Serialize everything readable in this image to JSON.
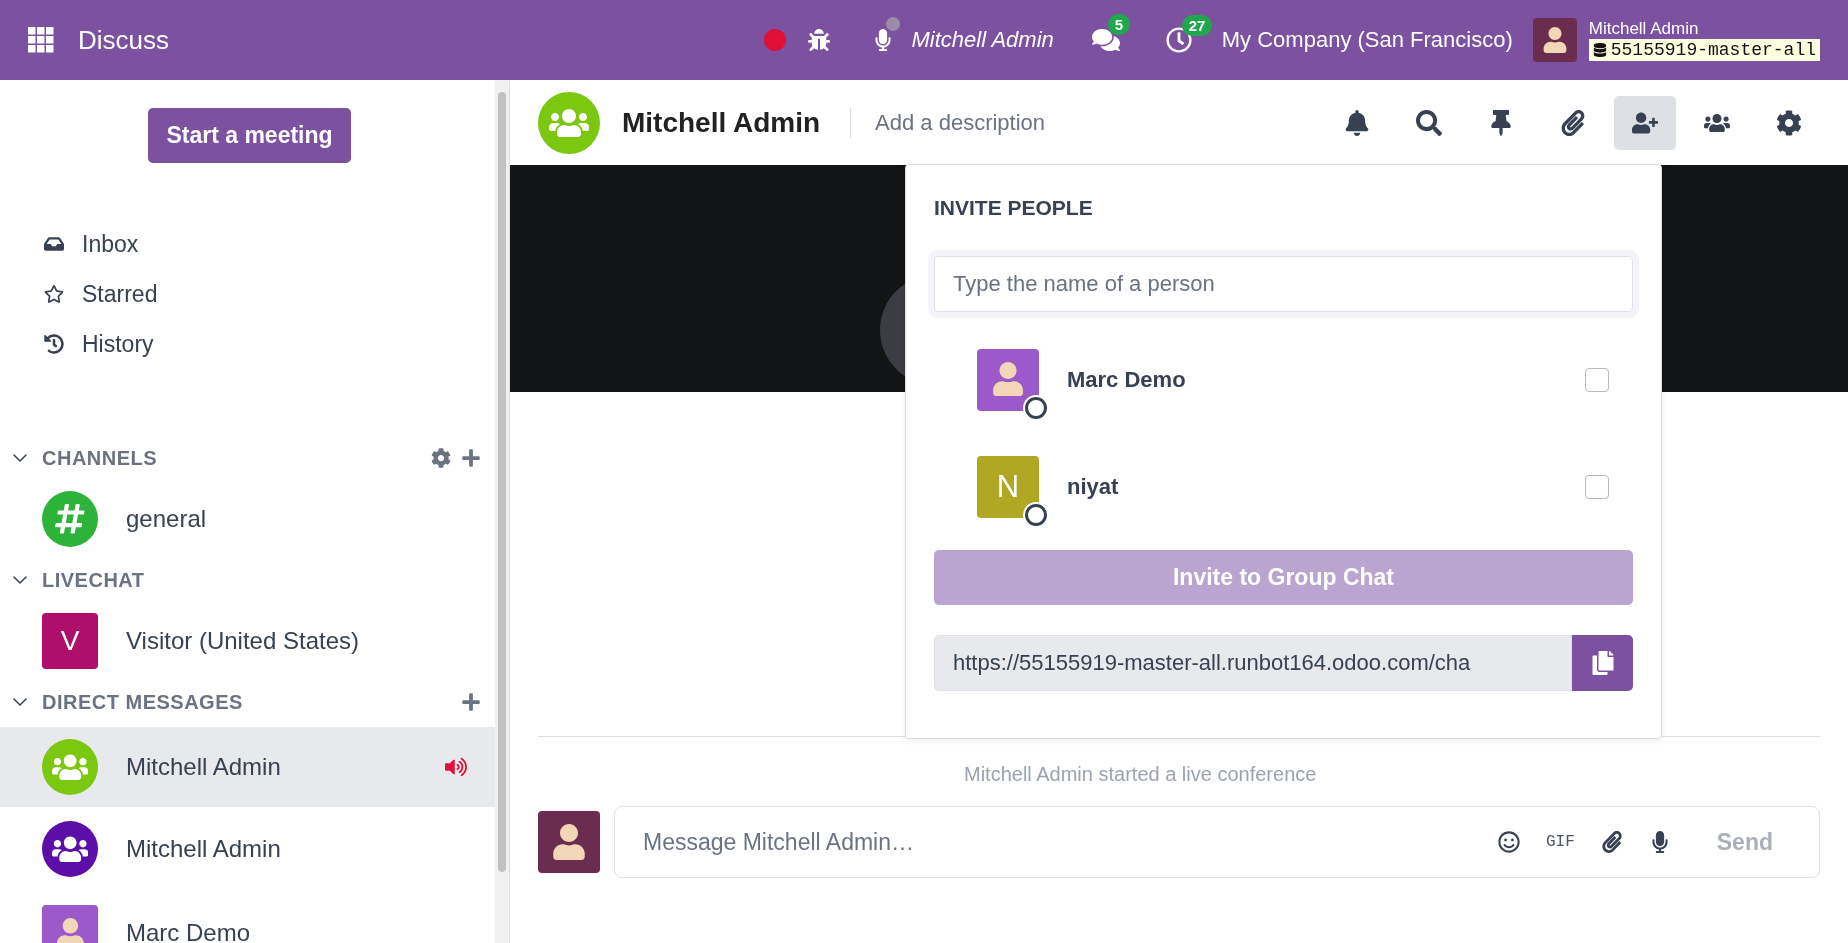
{
  "topbar": {
    "app_name": "Discuss",
    "recording": true,
    "mic_muted": true,
    "call_user": "Mitchell Admin",
    "messages_count": "5",
    "activities_count": "27",
    "company": "My Company (San Francisco)",
    "user_name": "Mitchell Admin",
    "database": "55155919-master-all"
  },
  "sidebar": {
    "start_button": "Start a meeting",
    "nav": [
      {
        "label": "Inbox",
        "kind": "inbox",
        "selected": false
      },
      {
        "label": "Starred",
        "kind": "starred",
        "selected": false
      },
      {
        "label": "History",
        "kind": "history",
        "selected": false
      }
    ],
    "sections": [
      {
        "title": "CHANNELS",
        "expanded": true,
        "has_settings": true,
        "has_add": true,
        "items": [
          {
            "name": "general",
            "kind": "hash",
            "color": "#2eb33a",
            "selected": false,
            "in_call": false
          }
        ]
      },
      {
        "title": "LIVECHAT",
        "expanded": true,
        "has_settings": false,
        "has_add": false,
        "items": [
          {
            "name": "Visitor (United States)",
            "kind": "letter",
            "initial": "V",
            "color": "#ad0f6a",
            "selected": false,
            "in_call": false
          }
        ]
      },
      {
        "title": "DIRECT MESSAGES",
        "expanded": true,
        "has_settings": false,
        "has_add": true,
        "items": [
          {
            "name": "Mitchell Admin",
            "kind": "group",
            "color": "#7cc811",
            "selected": true,
            "in_call": true
          },
          {
            "name": "Mitchell Admin",
            "kind": "group",
            "color": "#5b0ea8",
            "selected": false,
            "in_call": false
          },
          {
            "name": "Marc Demo",
            "kind": "photo",
            "color": "#9b59c9",
            "selected": false,
            "in_call": false
          }
        ]
      }
    ]
  },
  "thread": {
    "name": "Mitchell Admin",
    "color": "#7cc811",
    "description_placeholder": "Add a description",
    "toolbar": [
      {
        "kind": "bell",
        "selected": false
      },
      {
        "kind": "search",
        "selected": false
      },
      {
        "kind": "pin",
        "selected": false
      },
      {
        "kind": "attachment",
        "selected": false
      },
      {
        "kind": "invite",
        "selected": true
      },
      {
        "kind": "members",
        "selected": false
      },
      {
        "kind": "settings",
        "selected": false
      }
    ],
    "notice": "Mitchell Admin started a live conference"
  },
  "invite": {
    "title": "INVITE PEOPLE",
    "search_placeholder": "Type the name of a person",
    "people": [
      {
        "name": "Marc Demo",
        "kind": "photo",
        "color": "#9b59c9",
        "checked": false
      },
      {
        "name": "niyat",
        "kind": "letter",
        "initial": "N",
        "color": "#b0a723",
        "checked": false
      }
    ],
    "invite_button": "Invite to Group Chat",
    "invite_disabled": true,
    "link": "https://55155919-master-all.runbot164.odoo.com/cha"
  },
  "composer": {
    "placeholder": "Message Mitchell Admin…",
    "gif": "GIF",
    "send": "Send",
    "send_disabled": true
  }
}
